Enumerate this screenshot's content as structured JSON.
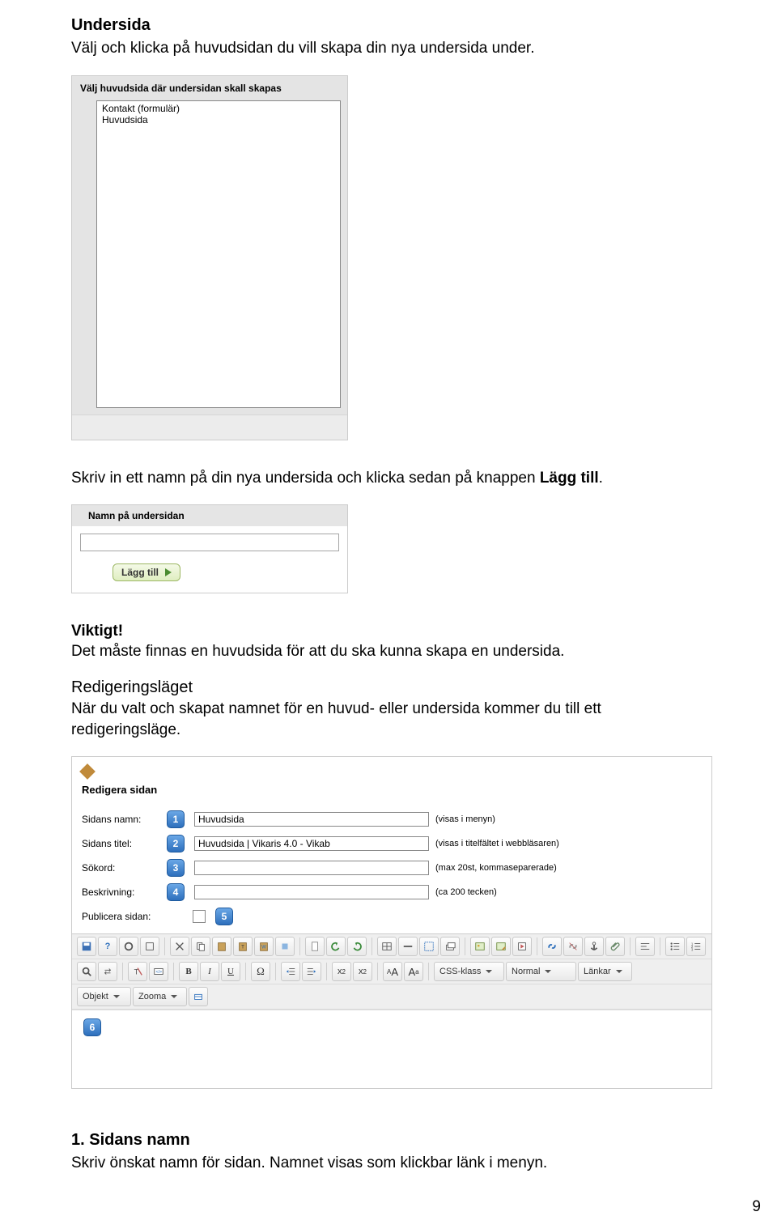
{
  "heading1": "Undersida",
  "intro": "Välj och klicka på huvudsidan du vill skapa din nya undersida under.",
  "scr1": {
    "title": "Välj huvudsida där undersidan skall skapas",
    "items": [
      "Kontakt (formulär)",
      "Huvudsida"
    ]
  },
  "mid_sentence_pre": "Skriv in ett namn på din nya undersida och klicka sedan på knappen ",
  "mid_sentence_bold": "Lägg till",
  "mid_sentence_post": ".",
  "scr2": {
    "title": "Namn på undersidan",
    "input_value": "",
    "button_label": "Lägg till"
  },
  "important_label": "Viktigt!",
  "important_text": "Det måste finnas en huvudsida för att du ska kunna skapa en undersida.",
  "redig_heading": "Redigeringsläget",
  "redig_text": "När du valt och skapat namnet för en huvud- eller undersida kommer du till ett redigeringsläge.",
  "scr3": {
    "head": "Redigera sidan",
    "fields": [
      {
        "label": "Sidans namn:",
        "value": "Huvudsida",
        "hint": "(visas i menyn)"
      },
      {
        "label": "Sidans titel:",
        "value": "Huvudsida | Vikaris 4.0 - Vikab",
        "hint": "(visas i titelfältet i webbläsaren)"
      },
      {
        "label": "Sökord:",
        "value": "",
        "hint": "(max 20st, kommaseparerade)"
      },
      {
        "label": "Beskrivning:",
        "value": "",
        "hint": "(ca 200 tecken)"
      }
    ],
    "publish_label": "Publicera sidan:",
    "toolbar": {
      "row2": {
        "bold": "B",
        "italic": "I",
        "underline": "U",
        "sup_base": "x",
        "sup_exp": "2",
        "sub_base": "x",
        "sub_exp": "2",
        "aa1": "A",
        "aa1s": "A",
        "aa2": "A",
        "aa2s": "a",
        "css": "CSS-klass",
        "normal": "Normal",
        "lankar": "Länkar"
      },
      "row3": {
        "objekt": "Objekt",
        "zooma": "Zooma"
      }
    }
  },
  "item1_heading": "1. Sidans namn",
  "item1_text": "Skriv önskat namn för sidan. Namnet visas som klickbar länk i menyn.",
  "page_number": "9"
}
